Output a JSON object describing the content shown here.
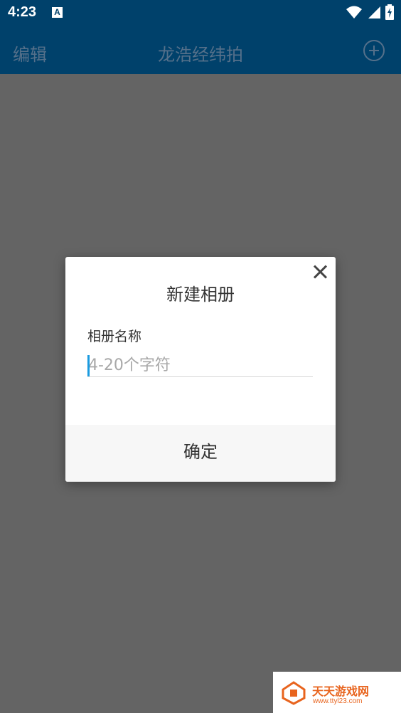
{
  "status_bar": {
    "time": "4:23",
    "app_icon_letter": "A"
  },
  "app_bar": {
    "edit_label": "编辑",
    "title": "龙浩经纬拍",
    "add_icon": "plus-circle-icon"
  },
  "dialog": {
    "title": "新建相册",
    "field_label": "相册名称",
    "input_placeholder": "4-20个字符",
    "input_value": "",
    "confirm_label": "确定",
    "close_icon": "close-icon"
  },
  "watermark": {
    "text": "天天游戏网",
    "url": "www.ttyl23.com"
  },
  "colors": {
    "app_bar": "#00416b",
    "overlay": "#646464",
    "caret": "#1a9be0",
    "watermark": "#e8641e"
  }
}
